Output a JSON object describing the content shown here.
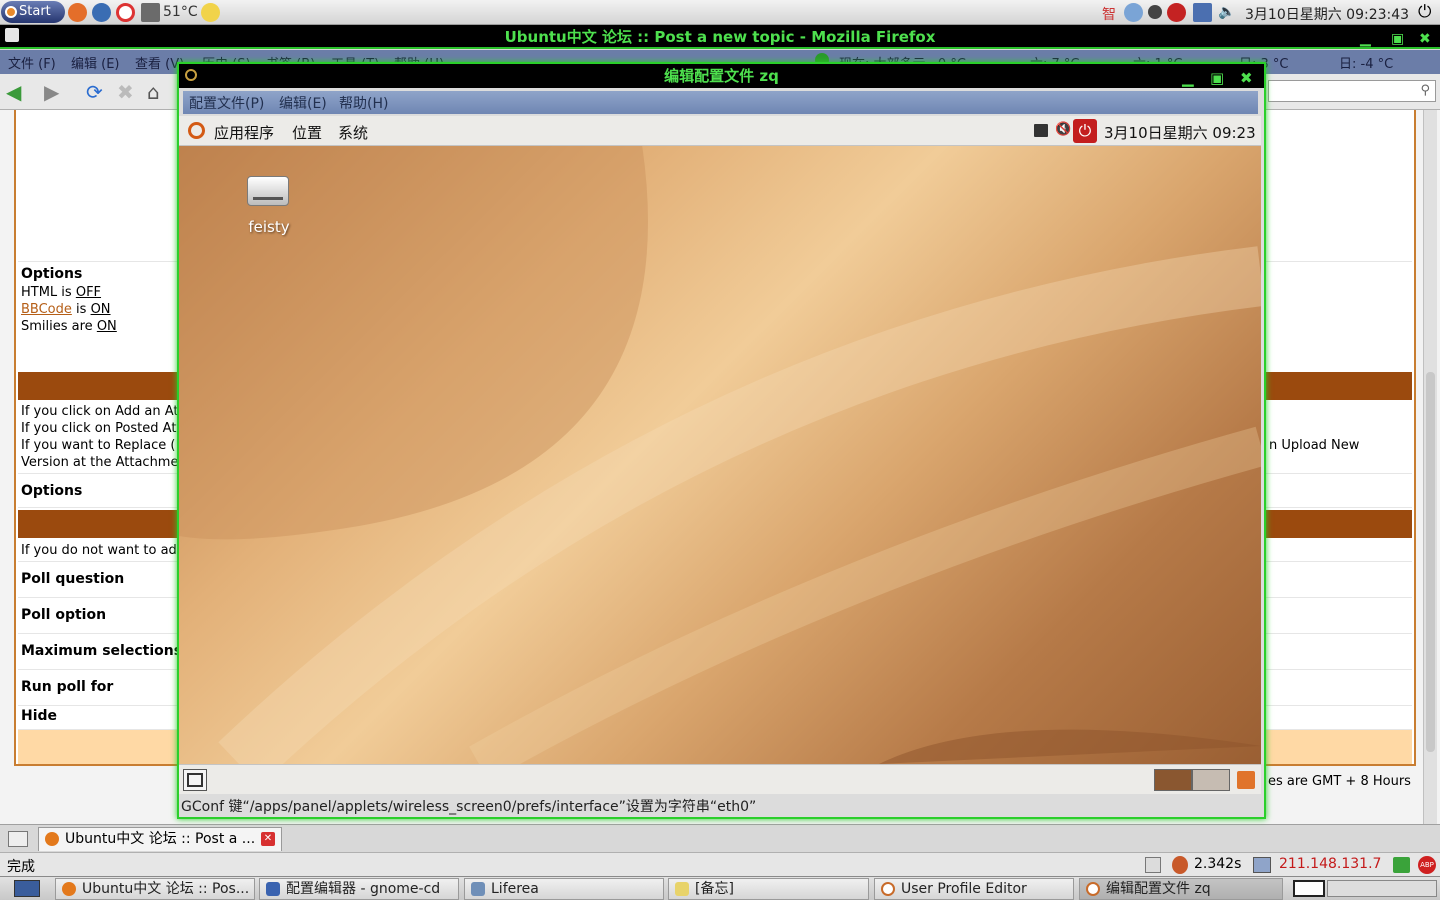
{
  "top_panel": {
    "start_label": "Start",
    "temperature": "51°C",
    "clock": "3月10日星期六 09:23:43"
  },
  "firefox": {
    "title": "Ubuntu中文 论坛 :: Post a new topic - Mozilla Firefox",
    "menu": [
      "文件 (F)",
      "编辑 (E)",
      "查看 (V)",
      "历史 (S)",
      "书签 (B)",
      "工具 (T)",
      "帮助 (H)"
    ],
    "weather": [
      "现在: 大部多云 · 0 °C",
      "六: 7 °C",
      "六: 1 °C",
      "日: 3 °C",
      "日: -4 °C"
    ],
    "forum": {
      "options_heading": "Options",
      "html_line": {
        "prefix": "HTML is",
        "value": "OFF"
      },
      "bbcode_line": {
        "link": "BBCode",
        "mid": "is",
        "value": "ON"
      },
      "smilies_line": {
        "prefix": "Smilies are",
        "value": "ON"
      },
      "attach_help": [
        "If you click on Add an At",
        "If you click on Posted At",
        "If you want to Replace (",
        "Version at the Attachme"
      ],
      "attach_right": "n Upload New",
      "options2": "Options",
      "poll_help": "If you do not want to add",
      "poll_question": "Poll question",
      "poll_option": "Poll option",
      "max_selections": "Maximum selections",
      "run_poll": "Run poll for",
      "hide": "Hide",
      "timezone": "es are GMT + 8 Hours"
    },
    "tab_label": "Ubuntu中文 论坛 :: Post a ...",
    "status": "完成",
    "timing": "2.342s",
    "ip": "211.148.131.7"
  },
  "dialog": {
    "title": "编辑配置文件 zq",
    "menu": [
      "配置文件(P)",
      "编辑(E)",
      "帮助(H)"
    ],
    "panel_menu": [
      "应用程序",
      "位置",
      "系统"
    ],
    "panel_clock": "3月10日星期六 09:23",
    "desktop_icon_label": "feisty",
    "status": "GConf 键“/apps/panel/applets/wireless_screen0/prefs/interface”设置为字符串“eth0”"
  },
  "taskbar": {
    "items": [
      "Ubuntu中文 论坛 :: Pos...",
      "配置编辑器 - gnome-cd",
      "Liferea",
      "[备忘]",
      "User Profile Editor",
      "编辑配置文件 zq"
    ]
  },
  "colors": {
    "title_green": "#4ee04e",
    "forum_brown": "#9b4a0e",
    "forum_peach": "#ffd9a5",
    "link_orange": "#b55e16"
  }
}
